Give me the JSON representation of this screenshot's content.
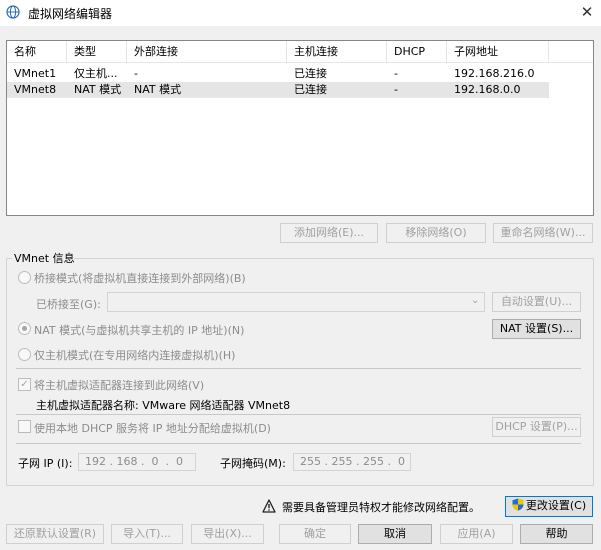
{
  "window": {
    "title": "虚拟网络编辑器",
    "close": "✕"
  },
  "table": {
    "columns": [
      "名称",
      "类型",
      "外部连接",
      "主机连接",
      "DHCP",
      "子网地址"
    ],
    "rows": [
      [
        "VMnet1",
        "仅主机...",
        "-",
        "已连接",
        "-",
        "192.168.216.0"
      ],
      [
        "VMnet8",
        "NAT 模式",
        "NAT 模式",
        "已连接",
        "-",
        "192.168.0.0"
      ]
    ],
    "selected_row": 1
  },
  "network_buttons": {
    "add": "添加网络(E)...",
    "remove": "移除网络(O)",
    "rename": "重命名网络(W)..."
  },
  "vmnet_info": {
    "group_title": "VMnet 信息",
    "bridged_label": "桥接模式(将虚拟机直接连接到外部网络)(B)",
    "bridged_to_label": "已桥接至(G):",
    "auto_settings": "自动设置(U)...",
    "nat_label": "NAT 模式(与虚拟机共享主机的 IP 地址)(N)",
    "nat_settings": "NAT 设置(S)...",
    "host_only_label": "仅主机模式(在专用网络内连接虚拟机)(H)",
    "connect_adapter_label": "将主机虚拟适配器连接到此网络(V)",
    "adapter_name_label": "主机虚拟适配器名称: VMware 网络适配器 VMnet8",
    "dhcp_label": "使用本地 DHCP 服务将 IP 地址分配给虚拟机(D)",
    "dhcp_settings": "DHCP 设置(P)...",
    "subnet_ip_label": "子网 IP (I):",
    "subnet_ip_value": "192 . 168 .  0  .  0",
    "subnet_mask_label": "子网掩码(M):",
    "subnet_mask_value": "255 . 255 . 255 .  0",
    "selected_mode": "nat",
    "connect_adapter_checked": true,
    "dhcp_checked": false
  },
  "admin": {
    "notice": "需要具备管理员特权才能修改网络配置。",
    "change_settings": "更改设置(C)"
  },
  "footer": {
    "restore": "还原默认设置(R)",
    "import": "导入(T)...",
    "export": "导出(X)...",
    "ok": "确定",
    "cancel": "取消",
    "apply": "应用(A)",
    "help": "帮助"
  },
  "icons": [
    "app-network-icon",
    "close-icon",
    "warning-icon",
    "uac-shield-icon",
    "chevron-down-icon"
  ]
}
